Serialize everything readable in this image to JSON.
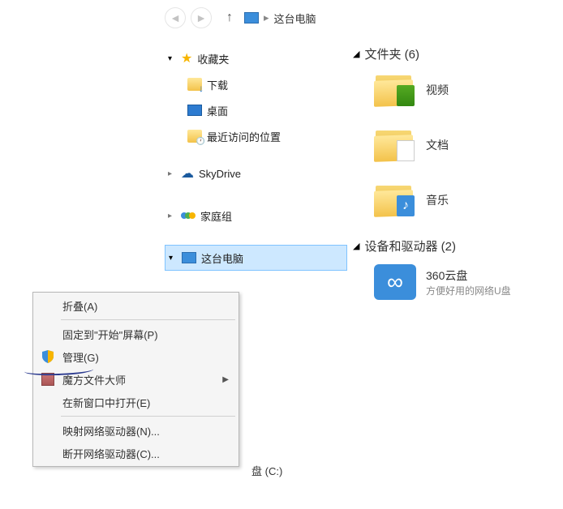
{
  "breadcrumb": {
    "location": "这台电脑"
  },
  "tree": {
    "favorites": {
      "label": "收藏夹",
      "items": [
        {
          "label": "下载"
        },
        {
          "label": "桌面"
        },
        {
          "label": "最近访问的位置"
        }
      ]
    },
    "skydrive": {
      "label": "SkyDrive"
    },
    "homegroup": {
      "label": "家庭组"
    },
    "thispc": {
      "label": "这台电脑"
    }
  },
  "content": {
    "folders_header": "文件夹 (6)",
    "devices_header": "设备和驱动器 (2)",
    "folders": [
      {
        "label": "视频",
        "name": "videos"
      },
      {
        "label": "文档",
        "name": "documents"
      },
      {
        "label": "音乐",
        "name": "music"
      }
    ],
    "devices": [
      {
        "label": "360云盘",
        "sub": "方便好用的网络U盘"
      }
    ],
    "partial_drive": "盘 (C:)"
  },
  "context_menu": {
    "collapse": "折叠(A)",
    "pin_start": "固定到\"开始\"屏幕(P)",
    "manage": "管理(G)",
    "mofang": "魔方文件大师",
    "new_window": "在新窗口中打开(E)",
    "map_drive": "映射网络驱动器(N)...",
    "disconnect_drive": "断开网络驱动器(C)..."
  }
}
